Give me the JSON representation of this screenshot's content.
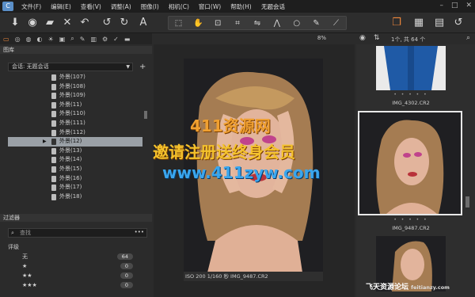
{
  "menubar": {
    "items": [
      "文件(F)",
      "编辑(E)",
      "查看(V)",
      "调整(A)",
      "图像(I)",
      "相机(C)",
      "窗口(W)",
      "帮助(H)"
    ],
    "title": "无题会话"
  },
  "left_panel": {
    "library_header": "图库",
    "session_label": "会话: 无题会话",
    "folders": [
      {
        "label": "外景(107)",
        "selected": false
      },
      {
        "label": "外景(108)",
        "selected": false
      },
      {
        "label": "外景(109)",
        "selected": false
      },
      {
        "label": "外景(11)",
        "selected": false
      },
      {
        "label": "外景(110)",
        "selected": false
      },
      {
        "label": "外景(111)",
        "selected": false
      },
      {
        "label": "外景(112)",
        "selected": false
      },
      {
        "label": "外景(12)",
        "selected": true
      },
      {
        "label": "外景(13)",
        "selected": false
      },
      {
        "label": "外景(14)",
        "selected": false
      },
      {
        "label": "外景(15)",
        "selected": false
      },
      {
        "label": "外景(16)",
        "selected": false
      },
      {
        "label": "外景(17)",
        "selected": false
      },
      {
        "label": "外景(18)",
        "selected": false
      }
    ],
    "filter_header": "过滤器",
    "search_placeholder": "查找",
    "rating_section": "评级",
    "ratings": [
      {
        "label": "无",
        "count": "64"
      },
      {
        "label": "★",
        "count": "0"
      },
      {
        "label": "★★",
        "count": "0"
      },
      {
        "label": "★★★",
        "count": "0"
      }
    ]
  },
  "viewer": {
    "zoom": "8%",
    "caption": "ISO 200   1/160 秒      IMG_9487.CR2"
  },
  "browser": {
    "count_label": "1个, 共 64 个",
    "thumbnails": [
      {
        "name": "IMG_4302.CR2"
      },
      {
        "name": "IMG_9487.CR2"
      }
    ]
  },
  "watermark": {
    "line1": "411资源网",
    "line2": "邀请注册送终身会员",
    "line3": "www.411zyw.com",
    "corner": "飞天资源论坛",
    "corner_small": "feitianzy.com"
  },
  "colors": {
    "accent": "#f0883c",
    "selection": "#9aa0a6"
  }
}
